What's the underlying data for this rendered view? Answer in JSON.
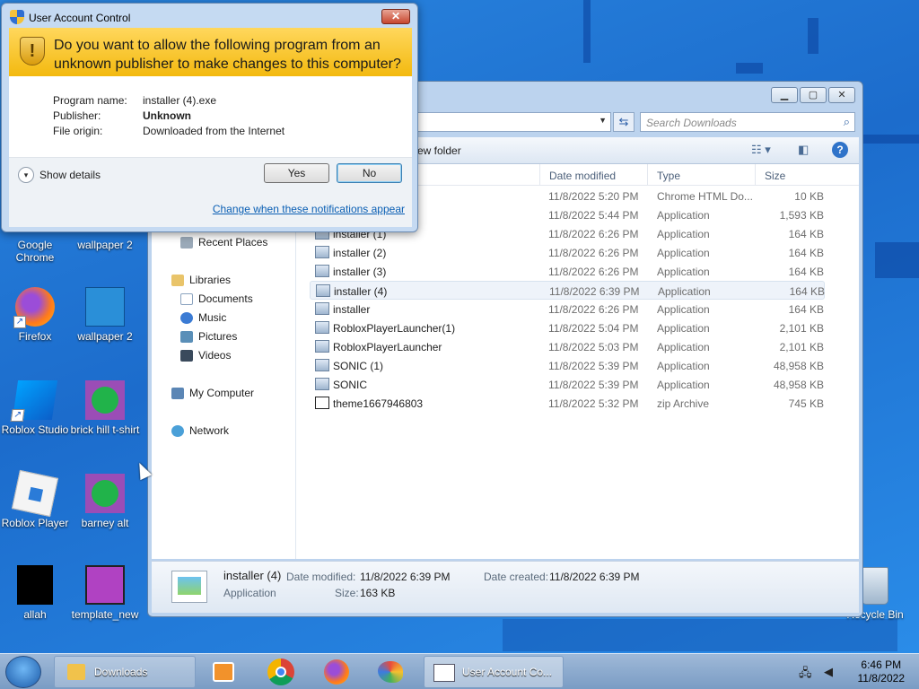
{
  "uac": {
    "title": "User Account Control",
    "close": "✕",
    "question": "Do you want to allow the following program from an unknown publisher to make changes to this computer?",
    "program_label": "Program name:",
    "program_value": "installer (4).exe",
    "publisher_label": "Publisher:",
    "publisher_value": "Unknown",
    "origin_label": "File origin:",
    "origin_value": "Downloaded from the Internet",
    "show_details": "Show details",
    "yes": "Yes",
    "no": "No",
    "link": "Change when these notifications appear"
  },
  "explorer": {
    "search_placeholder": "Search Downloads",
    "new_folder_partial": "ew folder",
    "columns": {
      "date": "Date modified",
      "type": "Type",
      "size": "Size"
    },
    "nav": {
      "recent": "Recent Places",
      "libraries": "Libraries",
      "documents": "Documents",
      "music": "Music",
      "pictures": "Pictures",
      "videos": "Videos",
      "computer": "My Computer",
      "network": "Network"
    },
    "files": [
      {
        "name": "",
        "date": "11/8/2022 5:20 PM",
        "type": "Chrome HTML Do...",
        "size": "10 KB"
      },
      {
        "name": "",
        "date": "11/8/2022 5:44 PM",
        "type": "Application",
        "size": "1,593 KB"
      },
      {
        "name": "installer (1)",
        "date": "11/8/2022 6:26 PM",
        "type": "Application",
        "size": "164 KB"
      },
      {
        "name": "installer (2)",
        "date": "11/8/2022 6:26 PM",
        "type": "Application",
        "size": "164 KB"
      },
      {
        "name": "installer (3)",
        "date": "11/8/2022 6:26 PM",
        "type": "Application",
        "size": "164 KB"
      },
      {
        "name": "installer (4)",
        "date": "11/8/2022 6:39 PM",
        "type": "Application",
        "size": "164 KB"
      },
      {
        "name": "installer",
        "date": "11/8/2022 6:26 PM",
        "type": "Application",
        "size": "164 KB"
      },
      {
        "name": "RobloxPlayerLauncher(1)",
        "date": "11/8/2022 5:04 PM",
        "type": "Application",
        "size": "2,101 KB"
      },
      {
        "name": "RobloxPlayerLauncher",
        "date": "11/8/2022 5:03 PM",
        "type": "Application",
        "size": "2,101 KB"
      },
      {
        "name": "SONIC (1)",
        "date": "11/8/2022 5:39 PM",
        "type": "Application",
        "size": "48,958 KB"
      },
      {
        "name": "SONIC",
        "date": "11/8/2022 5:39 PM",
        "type": "Application",
        "size": "48,958 KB"
      },
      {
        "name": "theme1667946803",
        "date": "11/8/2022 5:32 PM",
        "type": "zip Archive",
        "size": "745 KB"
      }
    ],
    "details": {
      "name": "installer (4)",
      "type": "Application",
      "modified_label": "Date modified:",
      "modified_value": "11/8/2022 6:39 PM",
      "created_label": "Date created:",
      "created_value": "11/8/2022 6:39 PM",
      "size_label": "Size:",
      "size_value": "163 KB"
    }
  },
  "desktop": {
    "icons": {
      "chrome": "Google Chrome",
      "wallpaper2a": "wallpaper 2",
      "firefox": "Firefox",
      "wallpaper2b": "wallpaper 2",
      "roblox_studio": "Roblox Studio",
      "brick_hill": "brick hill t-shirt",
      "roblox_player": "Roblox Player",
      "barney": "barney alt",
      "allah": "allah",
      "template": "template_new",
      "recycle": "Recycle Bin"
    }
  },
  "taskbar": {
    "downloads": "Downloads",
    "uac": "User Account Co...",
    "time": "6:46 PM",
    "date": "11/8/2022"
  }
}
